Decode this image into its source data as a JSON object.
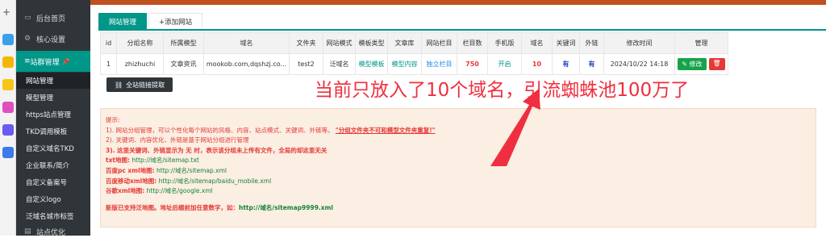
{
  "sidebar": {
    "items": [
      {
        "label": "后台首页",
        "icon": "monitor-icon"
      },
      {
        "label": "核心设置",
        "icon": "settings-icon"
      }
    ],
    "group": {
      "label": "站群管理",
      "pin": "📌"
    },
    "subitems": [
      {
        "label": "网站管理",
        "active": true
      },
      {
        "label": "模型管理"
      },
      {
        "label": "https站点管理"
      },
      {
        "label": "TKD调用模板"
      },
      {
        "label": "自定义域名TKD"
      },
      {
        "label": "企业联系/简介"
      },
      {
        "label": "自定义备案号"
      },
      {
        "label": "自定义logo"
      },
      {
        "label": "泛域名城市标签"
      }
    ],
    "bottom": {
      "label": "站点优化"
    }
  },
  "tabs": [
    {
      "label": "网站管理",
      "active": true
    },
    {
      "label": "+添加网站",
      "active": false
    }
  ],
  "table": {
    "headers": [
      "id",
      "分组名称",
      "所属模型",
      "域名",
      "文件夹",
      "网站模式",
      "模板类型",
      "文章库",
      "网站栏目",
      "栏目数",
      "手机版",
      "域名",
      "关键词",
      "外链",
      "修改时间",
      "管理"
    ],
    "rows": [
      {
        "id": "1",
        "group": "zhizhuchi",
        "model": "文章资讯",
        "domain": "mookob.com,dqshzj.co...",
        "folder": "test2",
        "mode": "泛域名",
        "template": "模型模板",
        "library": "模型内容",
        "column": "独立栏目",
        "column_count": "750",
        "mobile": "开启",
        "domain_count": "10",
        "keywords": "有",
        "links": "有",
        "time": "2024/10/22 14:18",
        "edit_label": "修改",
        "delete_label": "🗑"
      }
    ]
  },
  "extract_button": "全站链接提取",
  "overlay_text": "当前只放入了10个域名，引流蜘蛛池100万了",
  "tips": {
    "title": "提示:",
    "line1_pre": "1). 网站分组管理，可以个性化每个网站的风格、内容、站点模式、关键词、外链等。",
    "line1_warn": "\"分组文件夹不可和模型文件夹重复!\"",
    "line2": "2). 关键词、内容优化、外链是基于网站分组进行管理",
    "line3": "3). 这里关键词、外链显示为 无 时，表示该分组未上传有文件，全局的却这里无关",
    "txt_label": "txt地图:",
    "txt_url": "http://域名/sitemap.txt",
    "pc_label": "百度pc xml地图:",
    "pc_url": "http://域名/sitemap.xml",
    "mobile_label": "百度移动xml地图:",
    "mobile_url": "http://域名/sitemap/baidu_mobile.xml",
    "google_label": "谷歌xml地图:",
    "google_url": "http://域名/google.xml",
    "last_pre": "新版已支持泛地图。地址后缀前加任意数字，如：",
    "last_url": "http://域名/sitemap9999.xml"
  }
}
